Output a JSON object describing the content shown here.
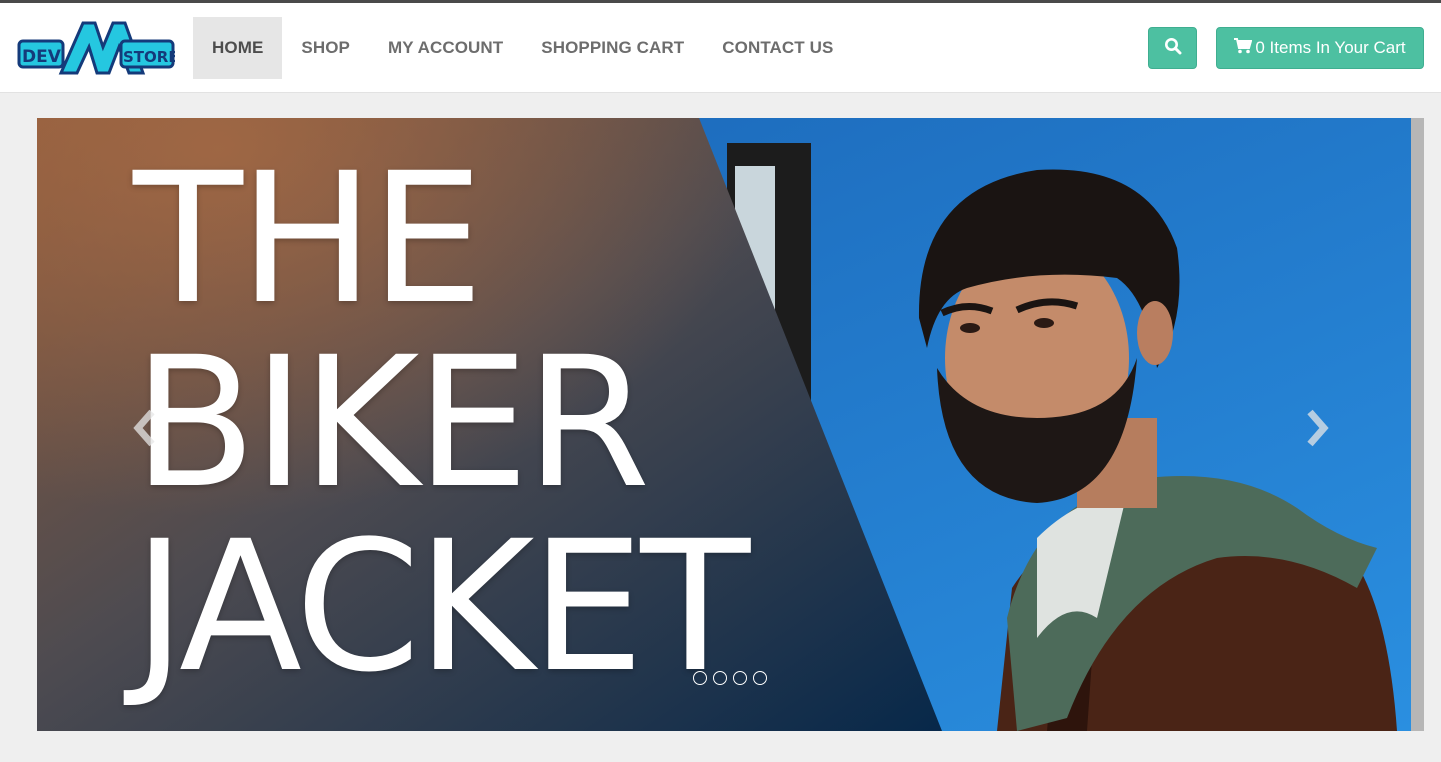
{
  "brand": {
    "logo_text_left": "DEV",
    "logo_text_right": "STORE"
  },
  "nav": {
    "items": [
      {
        "label": "HOME",
        "active": true
      },
      {
        "label": "SHOP"
      },
      {
        "label": "MY ACCOUNT"
      },
      {
        "label": "SHOPPING CART"
      },
      {
        "label": "CONTACT US"
      }
    ]
  },
  "header": {
    "search_icon": "search-icon",
    "cart_icon": "shopping-cart-icon",
    "cart_label": "0 Items In Your Cart"
  },
  "carousel": {
    "headline": [
      "THE",
      "BIKER",
      "JACKET"
    ],
    "prev_icon": "chevron-left-icon",
    "next_icon": "chevron-right-icon",
    "slide_count": 4,
    "active_slide": 1
  },
  "colors": {
    "accent": "#4dc0a1",
    "topline": "#4a4a4a",
    "slide_blue": "#1b6fc0"
  }
}
